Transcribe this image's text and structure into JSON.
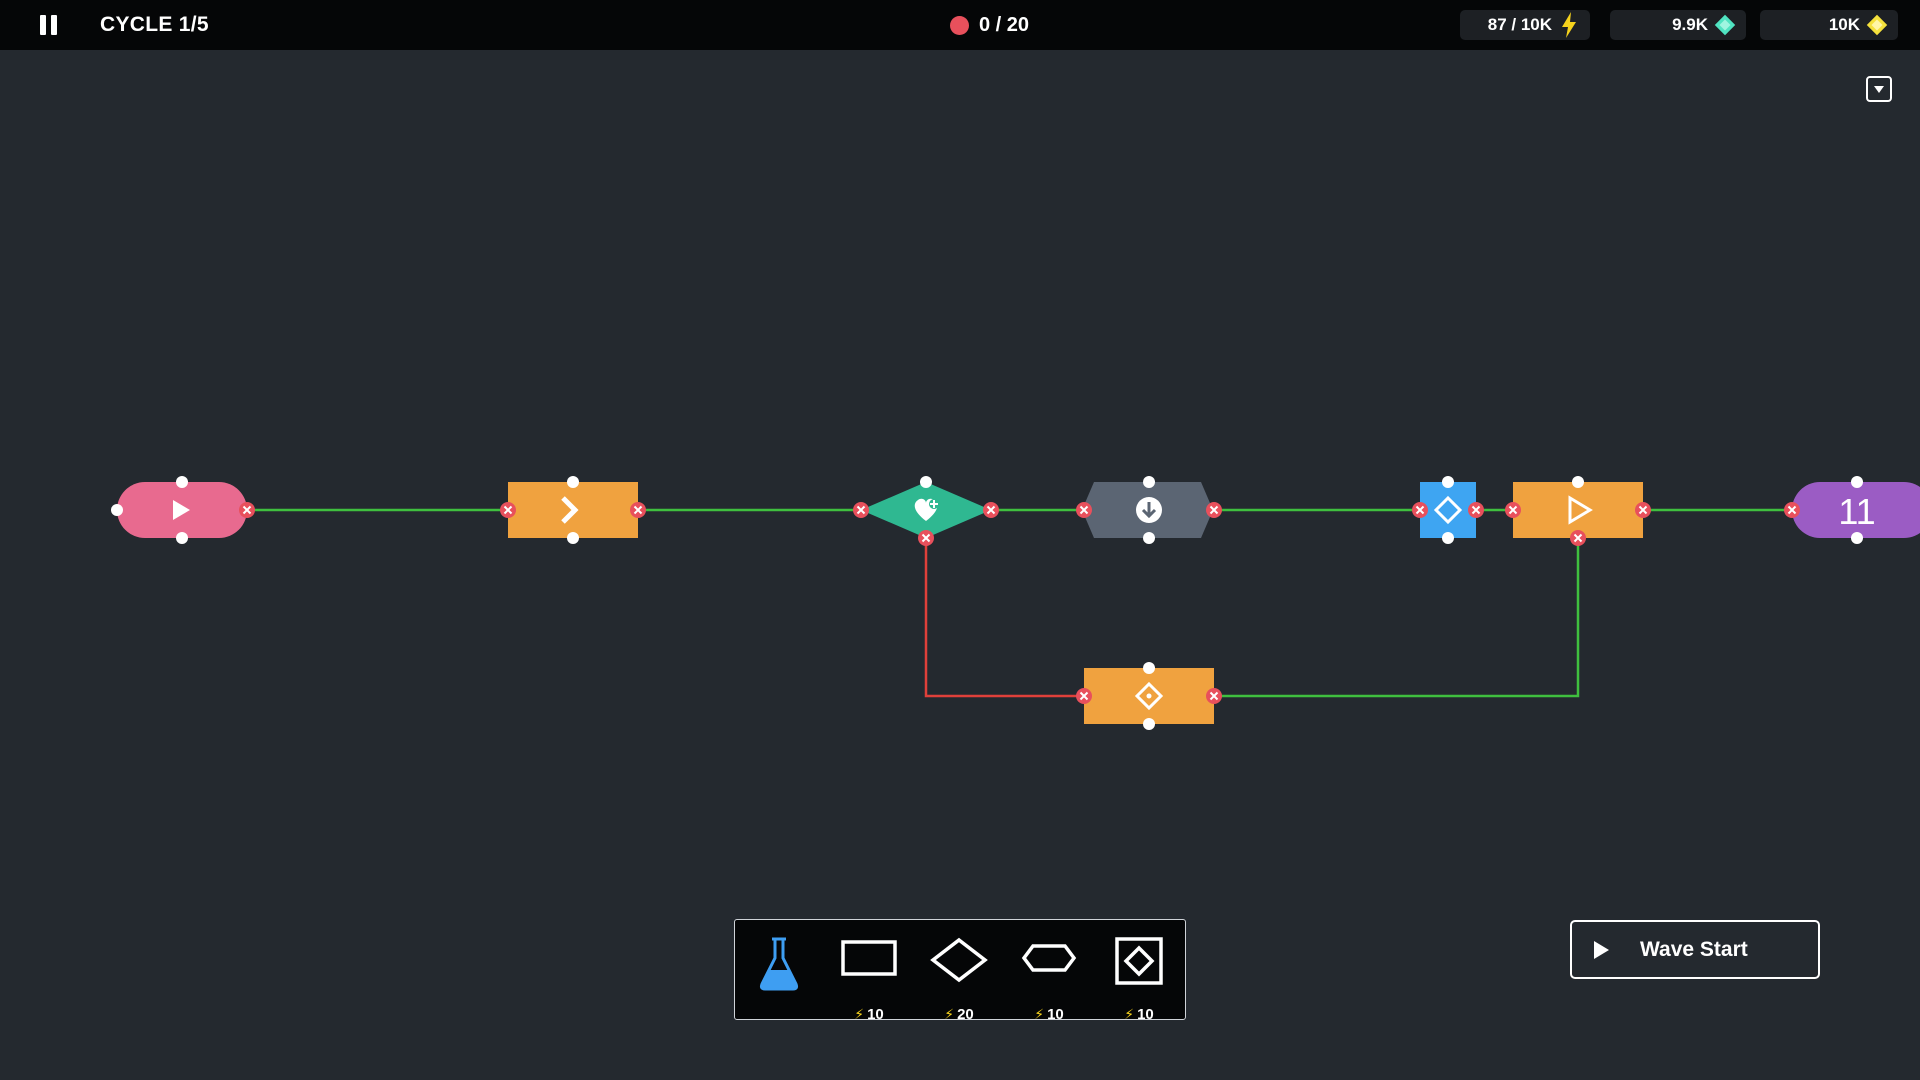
{
  "hud": {
    "cycle": "CYCLE 1/5",
    "enemies": "0 / 20",
    "energy": "87 / 10K",
    "gems": "9.9K",
    "gold": "10K"
  },
  "colors": {
    "background": "#24292f",
    "topbar": "#050607",
    "start_node": "#e86a8f",
    "orange_node": "#f0a23f",
    "heal_node": "#2fb891",
    "grey_node": "#5b6573",
    "blue_node": "#3ea5f2",
    "end_node": "#9b5cc4",
    "link_ok": "#3fbf3f",
    "link_bad": "#e0403a",
    "delete_marker": "#e8505c",
    "energy": "#f5d21c",
    "gem": "#4fe3c1",
    "gold": "#f5e13c",
    "flask": "#3e9ef2"
  },
  "graph": {
    "nodes": [
      {
        "id": "start",
        "shape": "pill",
        "icon": "play-icon"
      },
      {
        "id": "advance",
        "shape": "rect",
        "icon": "chevron-right-icon"
      },
      {
        "id": "heal",
        "shape": "diamond",
        "icon": "heart-plus-icon"
      },
      {
        "id": "drop",
        "shape": "hexagon",
        "icon": "arrow-down-circle-icon"
      },
      {
        "id": "blue-check",
        "shape": "square",
        "icon": "diamond-outline-icon"
      },
      {
        "id": "fire",
        "shape": "rect",
        "icon": "play-outline-icon"
      },
      {
        "id": "target",
        "shape": "rect",
        "icon": "diamond-dot-icon"
      },
      {
        "id": "end",
        "shape": "pill",
        "label": "11"
      }
    ]
  },
  "toolbar": {
    "items": [
      {
        "name": "flask-tool",
        "icon": "flask-icon",
        "cost": ""
      },
      {
        "name": "rectangle-tool",
        "icon": "rectangle-outline-icon",
        "cost": "10"
      },
      {
        "name": "diamond-tool",
        "icon": "diamond-outline-icon",
        "cost": "20"
      },
      {
        "name": "hexagon-tool",
        "icon": "hexagon-outline-icon",
        "cost": "10"
      },
      {
        "name": "diamond-square-tool",
        "icon": "diamond-in-square-icon",
        "cost": "10"
      }
    ]
  },
  "wave_button": {
    "label": "Wave Start"
  }
}
